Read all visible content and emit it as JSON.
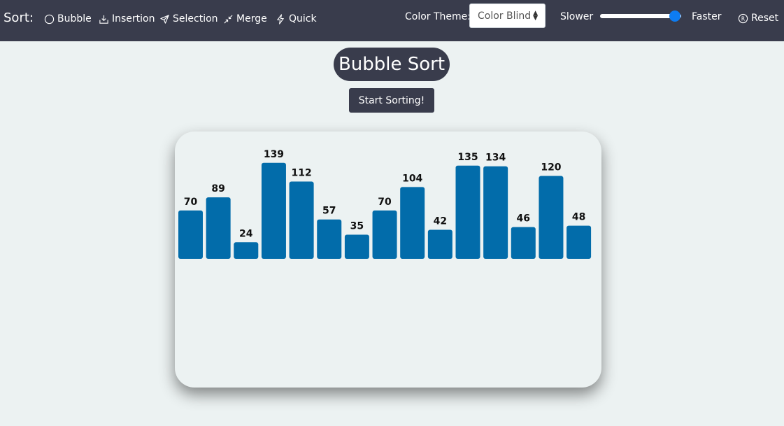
{
  "nav": {
    "brand": "Sort:",
    "items": [
      {
        "label": "Bubble",
        "icon": "circle-icon"
      },
      {
        "label": "Insertion",
        "icon": "download-tray-icon"
      },
      {
        "label": "Selection",
        "icon": "send-arrow-icon"
      },
      {
        "label": "Merge",
        "icon": "collapse-arrows-icon"
      },
      {
        "label": "Quick",
        "icon": "lightning-icon"
      }
    ],
    "theme_label": "Color Theme:",
    "theme_value": "Color Blind",
    "speed_slow": "Slower",
    "speed_fast": "Faster",
    "speed_value": 1.0,
    "reset_label": "Reset"
  },
  "main": {
    "title": "Bubble Sort",
    "start_button": "Start Sorting!"
  },
  "colors": {
    "navbar": "#393c4c",
    "background": "#ecf2f2",
    "bar": "#026caa",
    "slider_thumb": "#0d7cf2"
  },
  "chart_data": {
    "type": "bar",
    "values": [
      70,
      89,
      24,
      139,
      112,
      57,
      35,
      70,
      104,
      42,
      135,
      134,
      46,
      120,
      48
    ]
  }
}
